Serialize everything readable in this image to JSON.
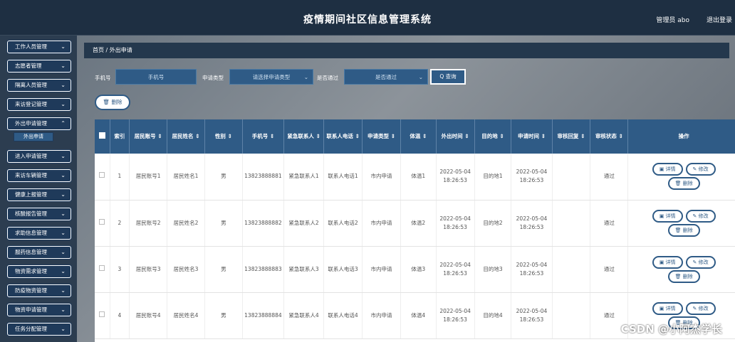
{
  "header": {
    "title": "疫情期间社区信息管理系统",
    "user": "管理员 abo",
    "logout": "退出登录"
  },
  "sidebar": {
    "items": [
      {
        "label": "工作人员管理"
      },
      {
        "label": "志愿者管理"
      },
      {
        "label": "隔离人员管理"
      },
      {
        "label": "来访登记管理"
      },
      {
        "label": "外出申请管理"
      },
      {
        "label": "进入申请管理"
      },
      {
        "label": "来访车辆管理"
      },
      {
        "label": "健康上报管理"
      },
      {
        "label": "核酸报告管理"
      },
      {
        "label": "求助信息管理"
      },
      {
        "label": "服药信息管理"
      },
      {
        "label": "物资需求管理"
      },
      {
        "label": "防疫物资管理"
      },
      {
        "label": "物资申请管理"
      },
      {
        "label": "任务分配管理"
      }
    ],
    "sub_item": "外出申请",
    "chevron": "chevron-down-icon"
  },
  "breadcrumb": "首页 / 外出申请",
  "filters": {
    "phone_label": "手机号",
    "phone_placeholder": "手机号",
    "type_label": "申请类型",
    "type_placeholder": "请选择申请类型",
    "pass_label": "是否通过",
    "pass_placeholder": "是否通过",
    "search": "Q 查询"
  },
  "delete_button": "🗑 删除",
  "table": {
    "headers": [
      "索引",
      "居民账号 ⇕",
      "居民姓名 ⇕",
      "性别 ⇕",
      "手机号 ⇕",
      "紧急联系人 ⇕",
      "联系人电话 ⇕",
      "申请类型 ⇕",
      "体温 ⇕",
      "外出时间 ⇕",
      "目的地 ⇕",
      "申请时间 ⇕",
      "审核回复 ⇕",
      "审核状态 ⇕",
      "操作"
    ],
    "rows": [
      {
        "idx": "1",
        "account": "居民账号1",
        "name": "居民姓名1",
        "sex": "男",
        "phone": "13823888881",
        "contact": "紧急联系人1",
        "contact_phone": "联系人电话1",
        "type": "市内申请",
        "temp": "体温1",
        "out_time": "2022-05-04 18:26:53",
        "dest": "目的地1",
        "apply_time": "2022-05-04 18:26:53",
        "reply": "",
        "status": "通过"
      },
      {
        "idx": "2",
        "account": "居民账号2",
        "name": "居民姓名2",
        "sex": "男",
        "phone": "13823888882",
        "contact": "紧急联系人2",
        "contact_phone": "联系人电话2",
        "type": "市内申请",
        "temp": "体温2",
        "out_time": "2022-05-04 18:26:53",
        "dest": "目的地2",
        "apply_time": "2022-05-04 18:26:53",
        "reply": "",
        "status": "通过"
      },
      {
        "idx": "3",
        "account": "居民账号3",
        "name": "居民姓名3",
        "sex": "男",
        "phone": "13823888883",
        "contact": "紧急联系人3",
        "contact_phone": "联系人电话3",
        "type": "市内申请",
        "temp": "体温3",
        "out_time": "2022-05-04 18:26:53",
        "dest": "目的地3",
        "apply_time": "2022-05-04 18:26:53",
        "reply": "",
        "status": "通过"
      },
      {
        "idx": "4",
        "account": "居民账号4",
        "name": "居民姓名4",
        "sex": "男",
        "phone": "13823888884",
        "contact": "紧急联系人4",
        "contact_phone": "联系人电话4",
        "type": "市内申请",
        "temp": "体温4",
        "out_time": "2022-05-04 18:26:53",
        "dest": "目的地4",
        "apply_time": "2022-05-04 18:26:53",
        "reply": "",
        "status": "通过"
      }
    ],
    "actions": {
      "detail": "详情",
      "edit": "修改",
      "delete": "删除"
    }
  },
  "watermark": "CSDN @小阿杰学长"
}
